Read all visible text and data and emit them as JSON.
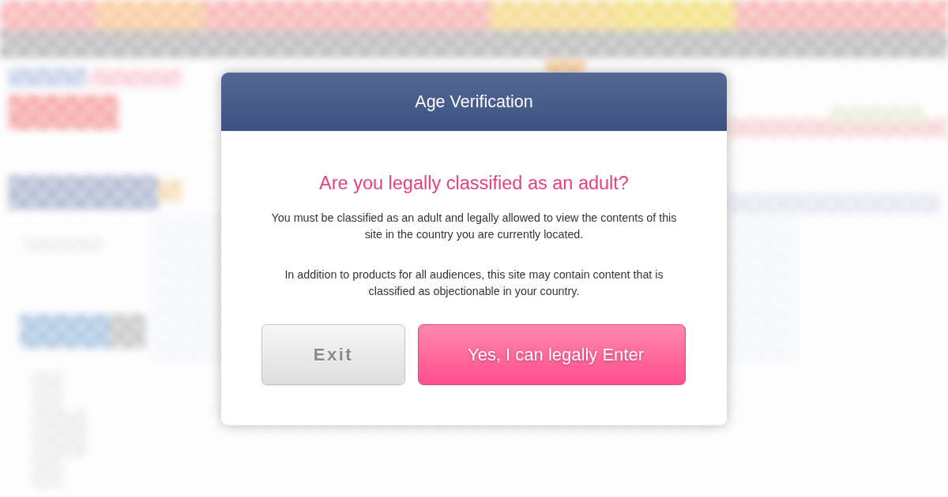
{
  "dialog": {
    "title": "Age Verification",
    "heading": "Are you legally classified as an adult?",
    "paragraphs": [
      "You must be classified as an adult and legally allowed to view the contents of this site in the country you are currently located.",
      "In addition to products for all audiences, this site may contain content that is classified as objectionable in your country."
    ],
    "buttons": [
      {
        "label": "Exit",
        "kind": "secondary"
      },
      {
        "label": "Yes, I can legally Enter",
        "kind": "primary"
      }
    ]
  }
}
